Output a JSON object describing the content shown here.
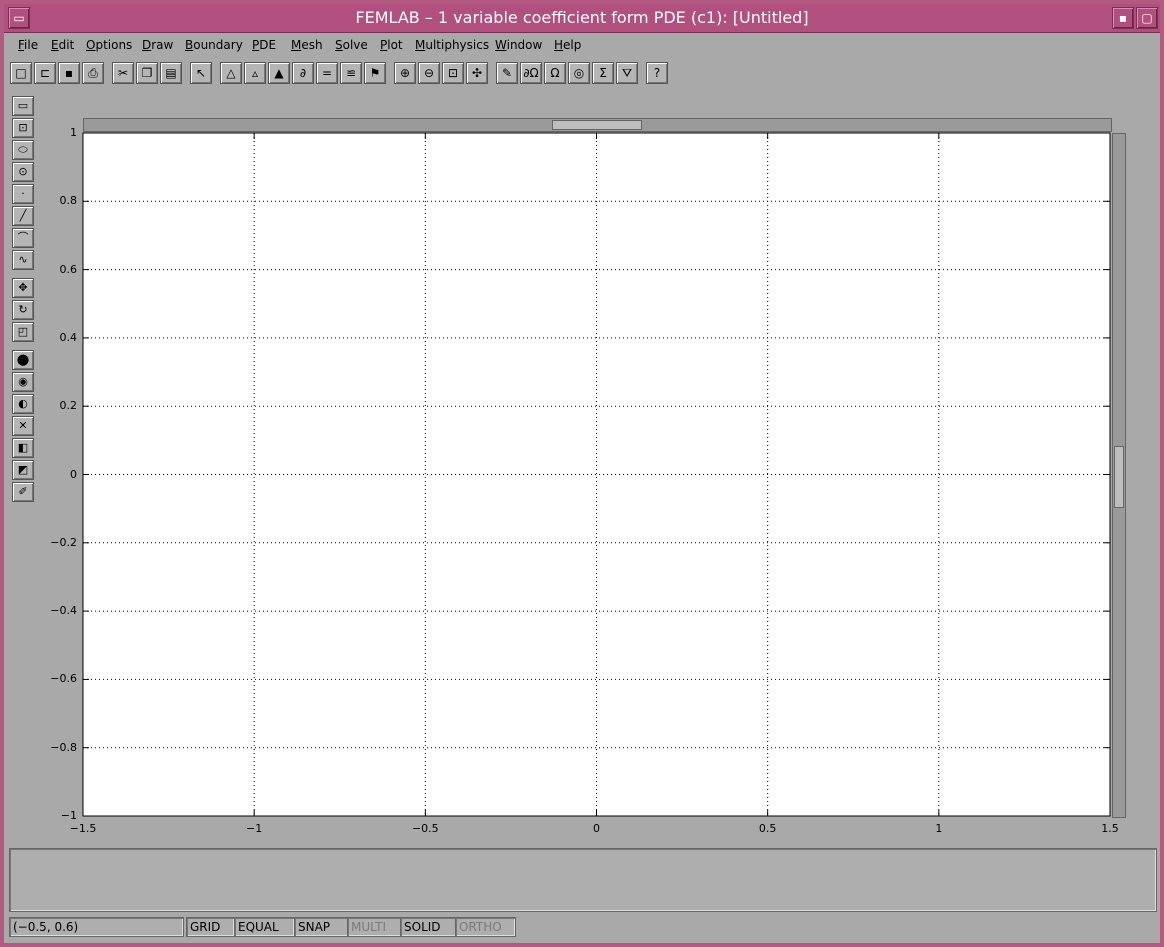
{
  "window": {
    "title": "FEMLAB – 1 variable coefficient form PDE (c1): [Untitled]",
    "controls": {
      "menu_glyph": "▭",
      "minimize_glyph": "▪",
      "maximize_glyph": "▢"
    }
  },
  "menubar": {
    "items": [
      {
        "label": "File",
        "mnemonic": "F",
        "rest": "ile"
      },
      {
        "label": "Edit",
        "mnemonic": "E",
        "rest": "dit"
      },
      {
        "label": "Options",
        "mnemonic": "O",
        "rest": "ptions"
      },
      {
        "label": "Draw",
        "mnemonic": "D",
        "rest": "raw"
      },
      {
        "label": "Boundary",
        "mnemonic": "B",
        "rest": "oundary"
      },
      {
        "label": "PDE",
        "mnemonic": "P",
        "rest": "DE"
      },
      {
        "label": "Mesh",
        "mnemonic": "M",
        "rest": "esh"
      },
      {
        "label": "Solve",
        "mnemonic": "S",
        "rest": "olve"
      },
      {
        "label": "Plot",
        "mnemonic": "P",
        "rest": "lot"
      },
      {
        "label": "Multiphysics",
        "mnemonic": "M",
        "rest": "ultiphysics"
      },
      {
        "label": "Window",
        "mnemonic": "W",
        "rest": "indow"
      },
      {
        "label": "Help",
        "mnemonic": "H",
        "rest": "elp"
      }
    ]
  },
  "toolbar": {
    "buttons": [
      {
        "icon": "new-file-icon",
        "glyph": "□"
      },
      {
        "icon": "open-folder-icon",
        "glyph": "⊏"
      },
      {
        "icon": "save-icon",
        "glyph": "▪"
      },
      {
        "icon": "print-icon",
        "glyph": "⎙"
      },
      {
        "icon": "cut-icon",
        "glyph": "✂"
      },
      {
        "icon": "copy-icon",
        "glyph": "❐"
      },
      {
        "icon": "paste-icon",
        "glyph": "▤"
      },
      {
        "icon": "select-arrow-icon",
        "glyph": "↖"
      },
      {
        "icon": "triangle-mesh-icon",
        "glyph": "△"
      },
      {
        "icon": "refine-mesh-icon",
        "glyph": "▵"
      },
      {
        "icon": "mesh-quality-icon",
        "glyph": "▲"
      },
      {
        "icon": "boundary-mode-icon",
        "glyph": "∂"
      },
      {
        "icon": "equal-icon",
        "glyph": "="
      },
      {
        "icon": "subdomain-icon",
        "glyph": "≌"
      },
      {
        "icon": "solve-icon",
        "glyph": "⚑"
      },
      {
        "icon": "zoom-in-icon",
        "glyph": "⊕"
      },
      {
        "icon": "zoom-out-icon",
        "glyph": "⊖"
      },
      {
        "icon": "zoom-window-icon",
        "glyph": "⊡"
      },
      {
        "icon": "zoom-extents-icon",
        "glyph": "✣"
      },
      {
        "icon": "draw-pencil-icon",
        "glyph": "✎"
      },
      {
        "icon": "boundary-coefficients-icon",
        "glyph": "∂Ω"
      },
      {
        "icon": "subdomain-omega-icon",
        "glyph": "Ω"
      },
      {
        "icon": "mesh-circle-icon",
        "glyph": "◎"
      },
      {
        "icon": "sigma-icon",
        "glyph": "Σ"
      },
      {
        "icon": "plot-icon",
        "glyph": "⛛"
      },
      {
        "icon": "help-icon",
        "glyph": "?"
      }
    ]
  },
  "sidebar": {
    "buttons": [
      {
        "icon": "rectangle-icon",
        "glyph": "▭"
      },
      {
        "icon": "rectangle-centered-icon",
        "glyph": "⊡"
      },
      {
        "icon": "ellipse-icon",
        "glyph": "⬭"
      },
      {
        "icon": "ellipse-centered-icon",
        "glyph": "⊙"
      },
      {
        "icon": "point-icon",
        "glyph": "·"
      },
      {
        "icon": "line-icon",
        "glyph": "╱"
      },
      {
        "icon": "arc-icon",
        "glyph": "⌒"
      },
      {
        "icon": "curve-icon",
        "glyph": "∿"
      },
      {
        "icon": "move-icon",
        "glyph": "✥"
      },
      {
        "icon": "rotate-icon",
        "glyph": "↻"
      },
      {
        "icon": "scale-icon",
        "glyph": "◰"
      },
      {
        "icon": "union-icon",
        "glyph": "⬤"
      },
      {
        "icon": "intersection-icon",
        "glyph": "◉"
      },
      {
        "icon": "difference-icon",
        "glyph": "◐"
      },
      {
        "icon": "split-icon",
        "glyph": "✕"
      },
      {
        "icon": "coerce-solid-icon",
        "glyph": "◧"
      },
      {
        "icon": "coerce-curve-icon",
        "glyph": "◩"
      },
      {
        "icon": "eyedropper-icon",
        "glyph": "✐"
      }
    ]
  },
  "axes": {
    "x_ticks": [
      "−1.5",
      "−1",
      "−0.5",
      "0",
      "0.5",
      "1",
      "1.5"
    ],
    "y_ticks": [
      "1",
      "0.8",
      "0.6",
      "0.4",
      "0.2",
      "0",
      "−0.2",
      "−0.4",
      "−0.6",
      "−0.8",
      "−1"
    ],
    "xlim": [
      -1.5,
      1.5
    ],
    "ylim": [
      -1,
      1
    ],
    "grid": true
  },
  "statusbar": {
    "coords": "(−0.5, 0.6)",
    "toggles": [
      {
        "label": "GRID",
        "enabled": true
      },
      {
        "label": "EQUAL",
        "enabled": true
      },
      {
        "label": "SNAP",
        "enabled": true
      },
      {
        "label": "MULTI",
        "enabled": false
      },
      {
        "label": "SOLID",
        "enabled": true
      },
      {
        "label": "ORTHO",
        "enabled": false
      }
    ]
  },
  "colors": {
    "titlebar": "#b14f7e",
    "frame": "#b35a82",
    "chrome": "#a9a9a9"
  }
}
